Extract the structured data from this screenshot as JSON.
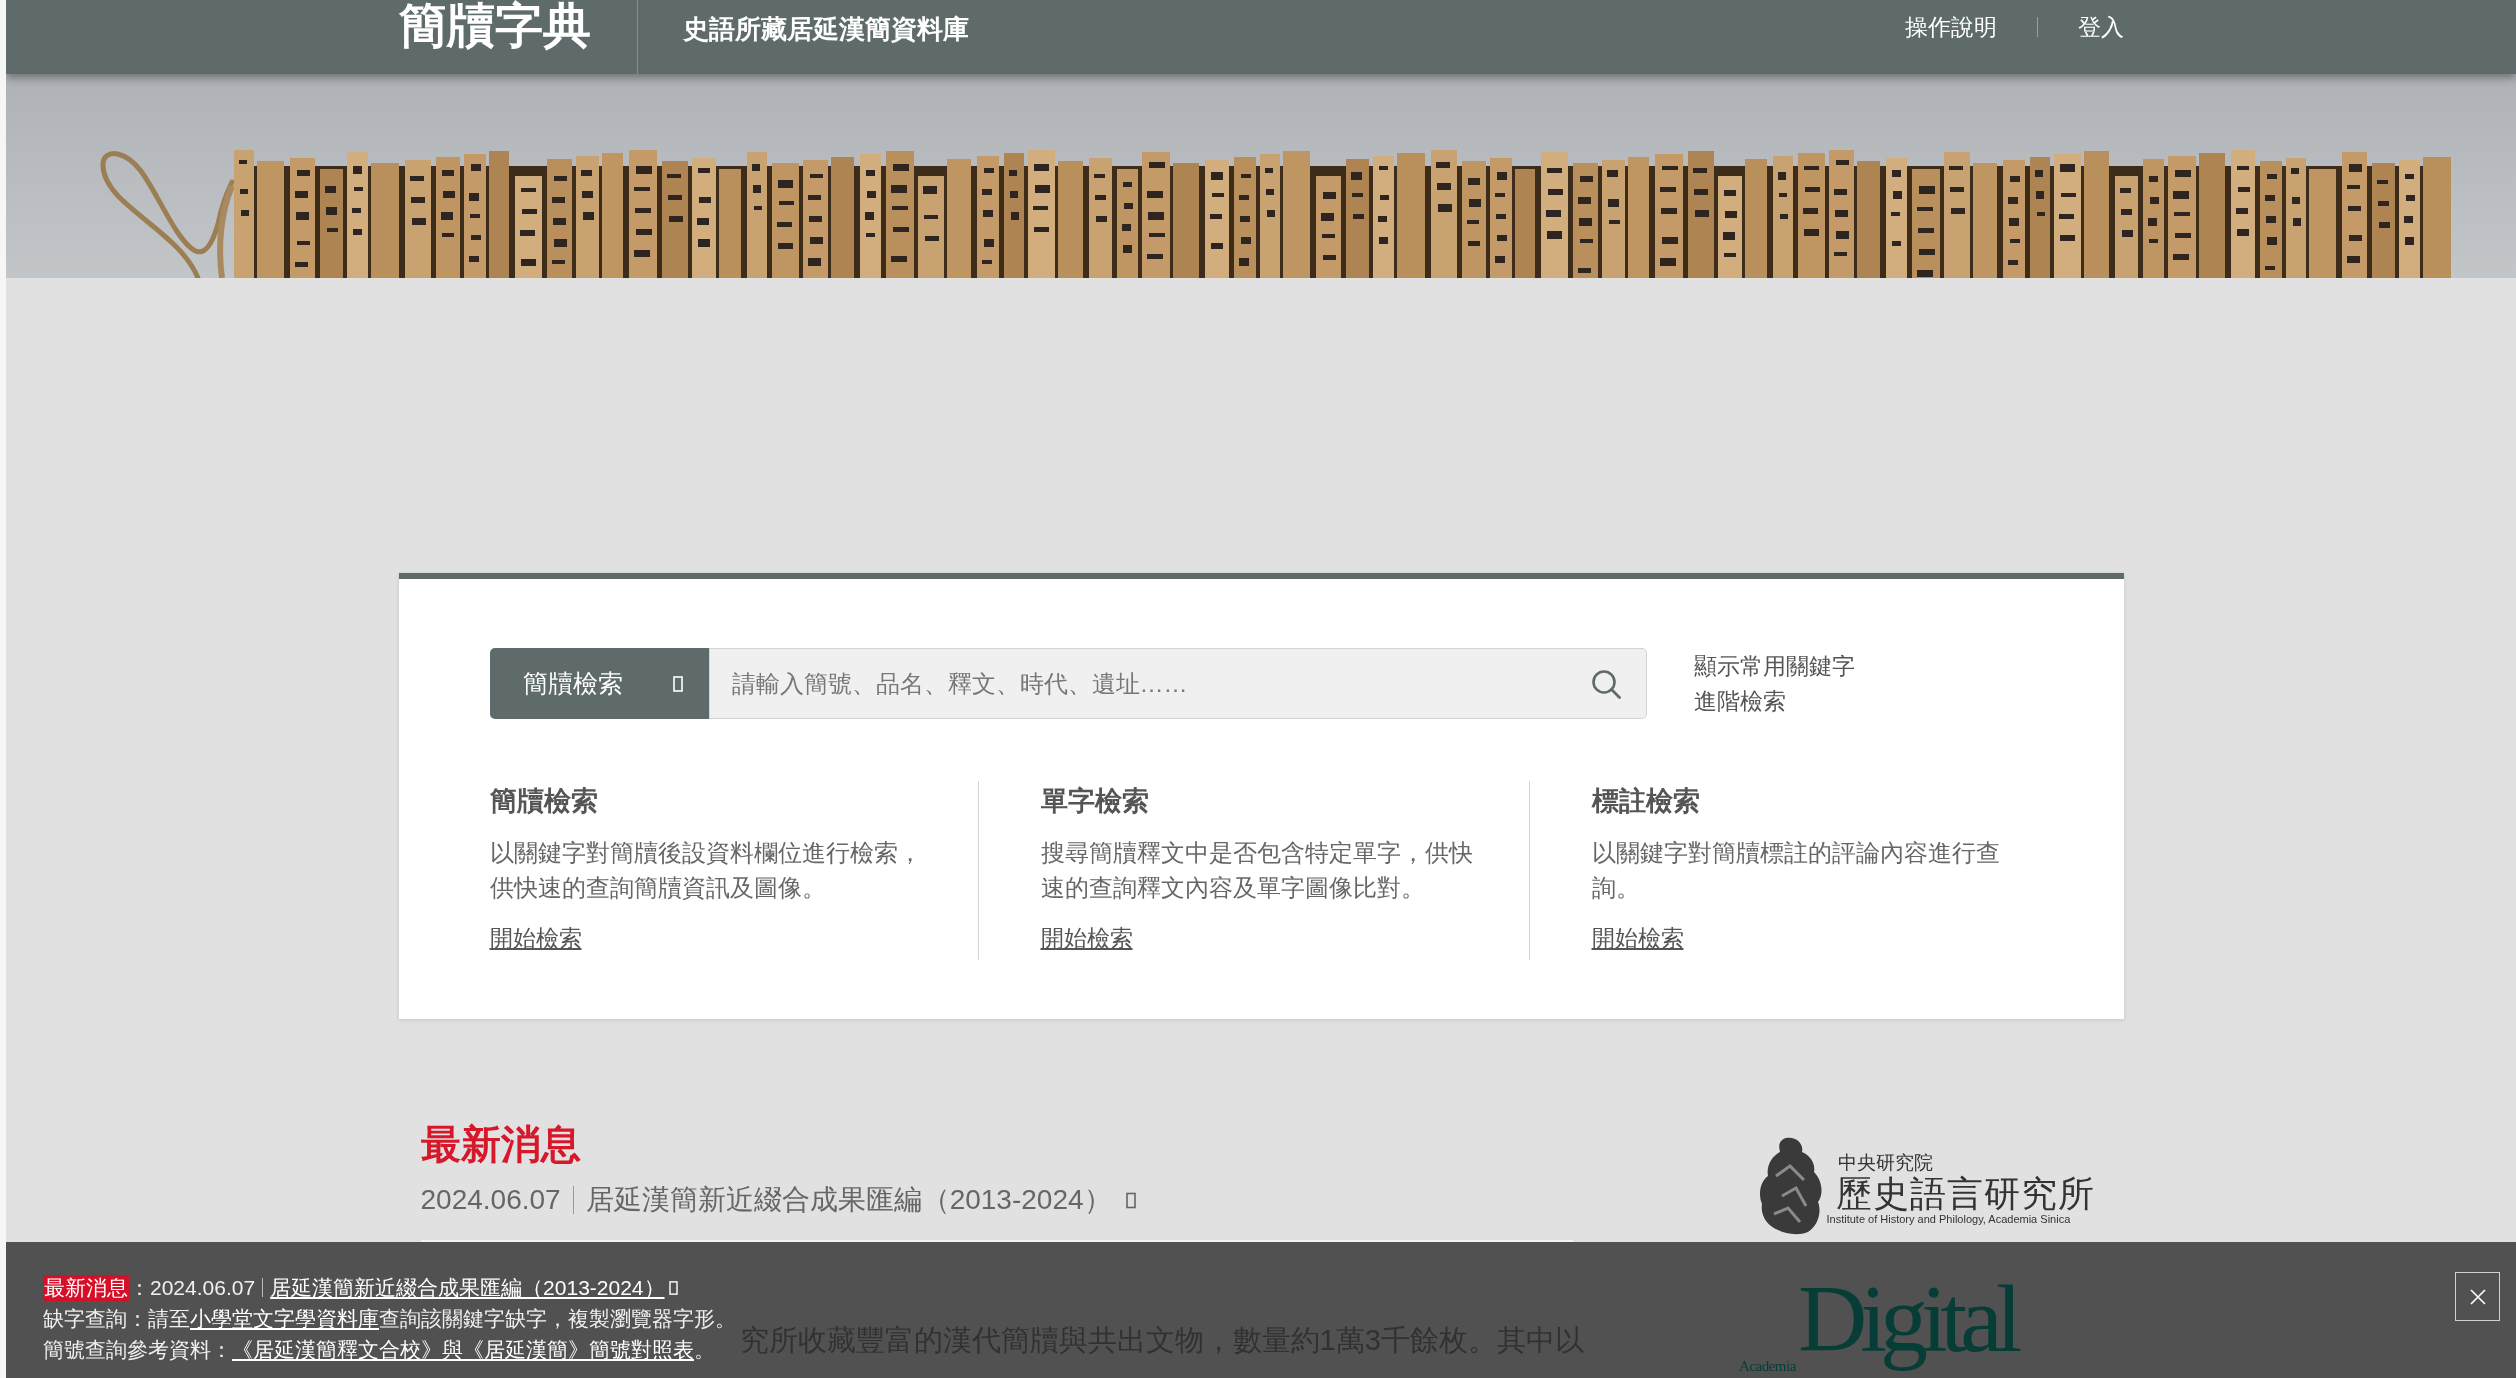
{
  "header": {
    "logo": "簡牘字典",
    "subtitle": "史語所藏居延漢簡資料庫",
    "nav": [
      {
        "label": "操作說明"
      },
      {
        "label": "登入"
      }
    ]
  },
  "search": {
    "category": "簡牘檢索",
    "placeholder": "請輸入簡號、品名、釋文、時代、遺址……",
    "links": [
      "顯示常用關鍵字",
      "進階檢索"
    ]
  },
  "search_modes": [
    {
      "title": "簡牘檢索",
      "description": "以關鍵字對簡牘後設資料欄位進行檢索，供快速的查詢簡牘資訊及圖像。",
      "link": "開始檢索"
    },
    {
      "title": "單字檢索",
      "description": "搜尋簡牘釋文中是否包含特定單字，供快速的查詢釋文內容及單字圖像比對。",
      "link": "開始檢索"
    },
    {
      "title": "標註檢索",
      "description": "以關鍵字對簡牘標註的評論內容進行查詢。",
      "link": "開始檢索"
    }
  ],
  "news": {
    "heading": "最新消息",
    "items": [
      {
        "date": "2024.06.07",
        "title": "居延漢簡新近綴合成果匯編（2013-2024）"
      }
    ]
  },
  "institute_logo": {
    "academy": "中央研究院",
    "institute": "歷史語言研究所",
    "institute_english": "Institute of History and Philology, Academia Sinica"
  },
  "intro_text": "究所收藏豐富的漢代簡牘與共出文物，數量約1萬3千餘枚。其中以",
  "partner_logo": {
    "name": "Digital",
    "academy": "Academia"
  },
  "notice_bar": {
    "label": "最新消息",
    "date": "：2024.06.07",
    "title": "居延漢簡新近綴合成果匯編（2013-2024）",
    "lines": [
      {
        "segments": [
          {
            "kind": "text",
            "text": "缺字查詢：請至"
          },
          {
            "kind": "link",
            "text": "小學堂文字學資料庫"
          },
          {
            "kind": "text",
            "text": "查詢該關鍵字缺字，複製瀏覽器字形。"
          }
        ]
      },
      {
        "segments": [
          {
            "kind": "text",
            "text": "簡號查詢參考資料："
          },
          {
            "kind": "link",
            "text": "《居延漢簡釋文合校》與《居延漢簡》簡號對照表"
          },
          {
            "kind": "text",
            "text": "。"
          }
        ]
      }
    ]
  }
}
